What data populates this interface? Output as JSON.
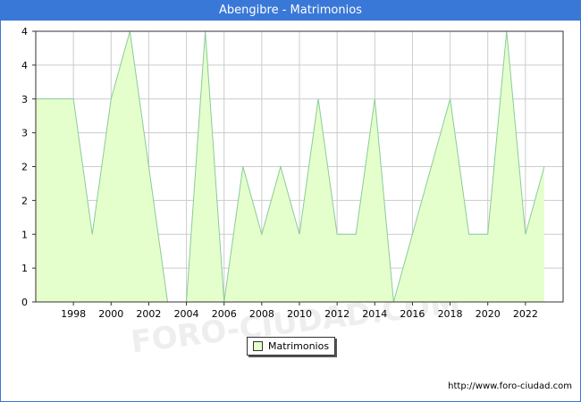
{
  "title": "Abengibre - Matrimonios",
  "watermark": "FORO-CIUDAD.COM",
  "source": "http://www.foro-ciudad.com",
  "colors": {
    "title_bar": "#3a78d8",
    "area_fill": "#e5ffcc",
    "area_line": "#88cc99",
    "grid": "#cccccc"
  },
  "chart_data": {
    "type": "area",
    "title": "Abengibre - Matrimonios",
    "xlabel": "",
    "ylabel": "",
    "series": [
      {
        "name": "Matrimonios",
        "x": [
          1996,
          1997,
          1998,
          1999,
          2000,
          2001,
          2002,
          2003,
          2004,
          2005,
          2006,
          2007,
          2008,
          2009,
          2010,
          2011,
          2012,
          2013,
          2014,
          2015,
          2016,
          2017,
          2018,
          2019,
          2020,
          2021,
          2022,
          2023
        ],
        "values": [
          3,
          3,
          3,
          1,
          3,
          4,
          2,
          0,
          0,
          4,
          0,
          2,
          1,
          2,
          1,
          3,
          1,
          1,
          3,
          0,
          1,
          2,
          3,
          1,
          1,
          4,
          1,
          2
        ]
      }
    ],
    "xlim": [
      1996,
      2024
    ],
    "ylim": [
      0,
      4
    ],
    "x_ticks": [
      "1998",
      "2000",
      "2002",
      "2004",
      "2006",
      "2008",
      "2010",
      "2012",
      "2014",
      "2016",
      "2018",
      "2020",
      "2022"
    ],
    "y_ticks": [
      "0",
      "1",
      "1",
      "2",
      "2",
      "3",
      "3",
      "4",
      "4"
    ],
    "grid": true,
    "legend": "bottom-center"
  }
}
